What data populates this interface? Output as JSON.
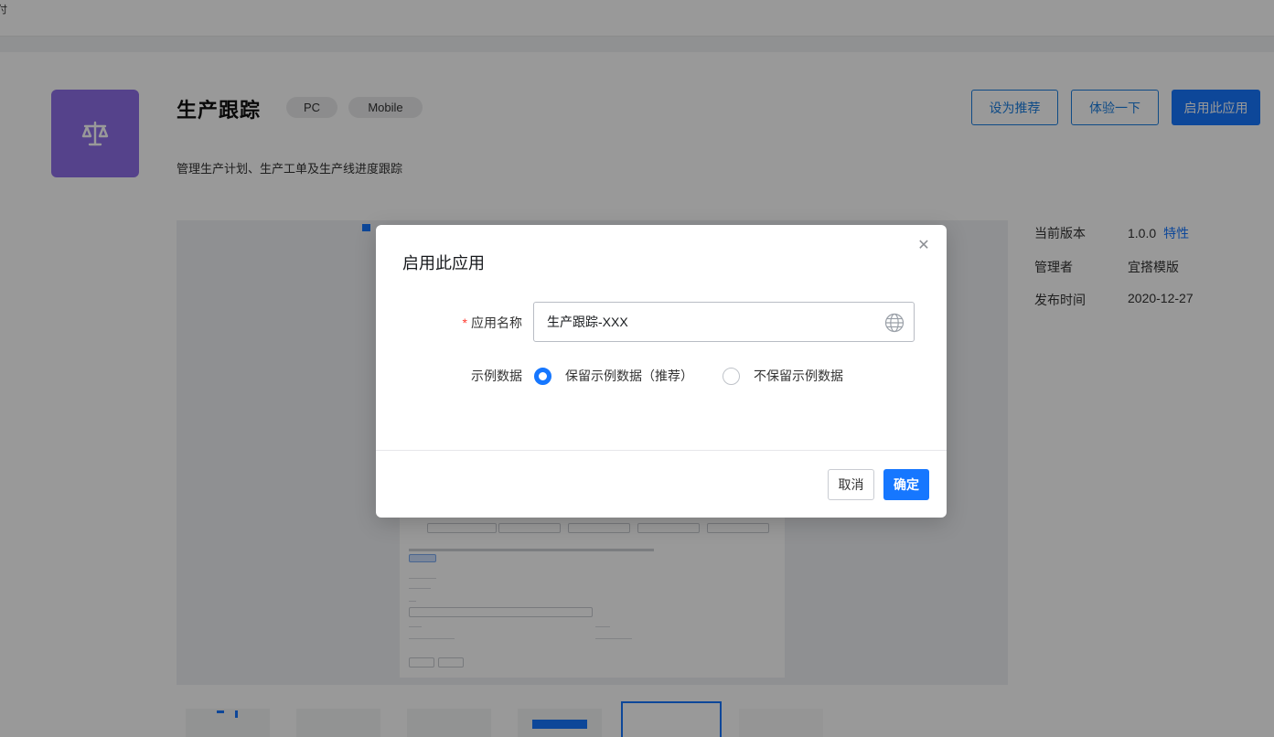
{
  "top_edge_glyph": "付",
  "app": {
    "title": "生产跟踪",
    "tags": [
      "PC",
      "Mobile"
    ],
    "description": "管理生产计划、生产工单及生产线进度跟踪",
    "icon": "scale-icon",
    "icon_color": "#8e6ee8"
  },
  "header_buttons": {
    "recommend": "设为推荐",
    "try": "体验一下",
    "enable": "启用此应用"
  },
  "info": {
    "version_label": "当前版本",
    "version_value": "1.0.0",
    "version_link": "特性",
    "admin_label": "管理者",
    "admin_value": "宜搭模版",
    "release_label": "发布时间",
    "release_value": "2020-12-27"
  },
  "thumbnails": {
    "count": 6,
    "active_index": 4
  },
  "modal": {
    "title": "启用此应用",
    "name_label": "应用名称",
    "name_required_mark": "*",
    "name_value": "生产跟踪-XXX",
    "sample_label": "示例数据",
    "options": [
      {
        "label": "保留示例数据（推荐）",
        "checked": true
      },
      {
        "label": "不保留示例数据",
        "checked": false
      }
    ],
    "cancel": "取消",
    "ok": "确定"
  },
  "colors": {
    "primary": "#1677ff",
    "mask": "rgba(0,0,0,0.40)",
    "required": "#ff3b30"
  }
}
